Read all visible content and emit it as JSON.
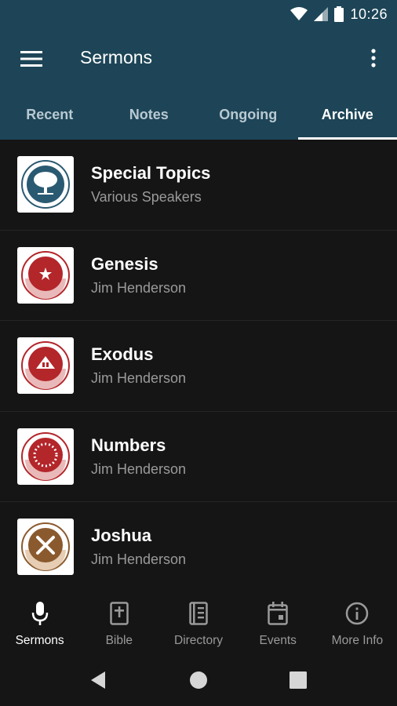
{
  "status_bar": {
    "time": "10:26"
  },
  "app_bar": {
    "title": "Sermons"
  },
  "tabs": [
    {
      "label": "Recent",
      "active": false
    },
    {
      "label": "Notes",
      "active": false
    },
    {
      "label": "Ongoing",
      "active": false
    },
    {
      "label": "Archive",
      "active": true
    }
  ],
  "series": [
    {
      "title": "Special Topics",
      "speaker": "Various Speakers",
      "icon": "tree-logo-icon"
    },
    {
      "title": "Genesis",
      "speaker": "Jim Henderson",
      "icon": "genesis-logo-icon"
    },
    {
      "title": "Exodus",
      "speaker": "Jim Henderson",
      "icon": "exodus-logo-icon"
    },
    {
      "title": "Numbers",
      "speaker": "Jim Henderson",
      "icon": "numbers-logo-icon"
    },
    {
      "title": "Joshua",
      "speaker": "Jim Henderson",
      "icon": "joshua-logo-icon"
    }
  ],
  "bottom_nav": [
    {
      "label": "Sermons",
      "icon": "microphone-icon",
      "active": true
    },
    {
      "label": "Bible",
      "icon": "bible-icon",
      "active": false
    },
    {
      "label": "Directory",
      "icon": "directory-icon",
      "active": false
    },
    {
      "label": "Events",
      "icon": "calendar-icon",
      "active": false
    },
    {
      "label": "More Info",
      "icon": "info-icon",
      "active": false
    }
  ],
  "colors": {
    "header": "#1d4557",
    "background": "#151515",
    "logo_red": "#b3262a",
    "logo_brown": "#8a5a2e",
    "logo_blue": "#2a5a72"
  }
}
